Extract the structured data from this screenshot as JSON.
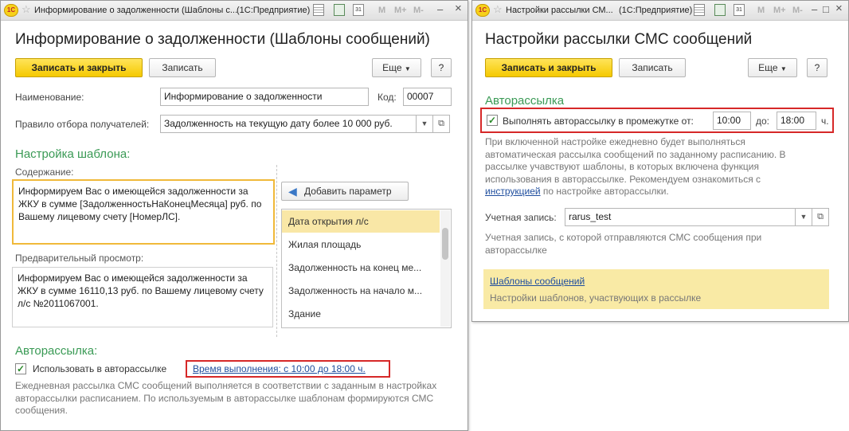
{
  "left_window": {
    "titlebar": {
      "app_label": "1С",
      "title": "Информирование о задолженности (Шаблоны с...",
      "app": "(1С:Предприятие)",
      "m1": "M",
      "m2": "M+",
      "m3": "M-",
      "calendar_day": "31",
      "minimize": "–",
      "maximize": "□",
      "close": "×"
    },
    "heading": "Информирование о задолженности (Шаблоны сообщений)",
    "toolbar": {
      "save_close": "Записать и закрыть",
      "save": "Записать",
      "more": "Еще",
      "help": "?"
    },
    "name_label": "Наименование:",
    "name_value": "Информирование о задолженности",
    "code_label": "Код:",
    "code_value": "00007",
    "rule_label": "Правило отбора получателей:",
    "rule_value": "Задолженность на текущую дату более 10 000 руб.",
    "template_section": "Настройка шаблона:",
    "content_label": "Содержание:",
    "content_text": "Информируем Вас о имеющейся задолженности за ЖКУ в сумме [ЗадолженностьНаКонецМесяца] руб. по Вашему лицевому счету [НомерЛС].",
    "add_param": "Добавить параметр",
    "params": [
      "Дата открытия л/с",
      "Жилая площадь",
      "Задолженность на конец ме...",
      "Задолженность на начало м...",
      "Здание"
    ],
    "preview_label": "Предварительный просмотр:",
    "preview_text": "Информируем Вас о имеющейся задолженности за ЖКУ в сумме 16110,13 руб. по Вашему лицевому счету л/с №2011067001.",
    "auto_section": "Авторассылка:",
    "auto_checkbox": "Использовать в авторассылке",
    "auto_link": "Время выполнения: с 10:00 до 18:00 ч.",
    "auto_note": "Ежедневная рассылка СМС сообщений выполняется в соответствии с заданным в настройках авторассылки расписанием. По используемым в авторассылке шаблонам формируются СМС сообщения."
  },
  "right_window": {
    "titlebar": {
      "app_label": "1С",
      "title": "Настройки рассылки СМ...",
      "app": "(1С:Предприятие)",
      "m1": "M",
      "m2": "M+",
      "m3": "M-",
      "calendar_day": "31",
      "minimize": "–",
      "maximize": "□",
      "close": "×"
    },
    "heading": "Настройки рассылки СМС сообщений",
    "toolbar": {
      "save_close": "Записать и закрыть",
      "save": "Записать",
      "more": "Еще",
      "help": "?"
    },
    "auto_section": "Авторассылка",
    "interval_label": "Выполнять авторассылку в промежутке от:",
    "from_value": "10:00",
    "to_label": "до:",
    "to_value": "18:00",
    "unit": "ч.",
    "note1": "При включенной настройке ежедневно будет выполняться автоматическая рассылка сообщений по заданному расписанию. В рассылке учавствуют шаблоны, в которых включена функция использования в авторассылке. Рекомендуем ознакомиться с",
    "note1_link": "инструкцией",
    "note1_tail": "по настройке авторассылки.",
    "account_label": "Учетная запись:",
    "account_value": "rarus_test",
    "account_note": "Учетная запись, с которой отправляются СМС сообщения при авторассылке",
    "templates_link": "Шаблоны сообщений",
    "templates_note": "Настройки шаблонов, участвующих в рассылке"
  },
  "colors": {
    "accent_yellow": "#f5c900",
    "section_green": "#3a9a55",
    "highlight_red": "#d62828",
    "link_blue": "#1f4e9e",
    "selected_row": "#f9e7a6",
    "info_panel": "#f9eaa5"
  }
}
